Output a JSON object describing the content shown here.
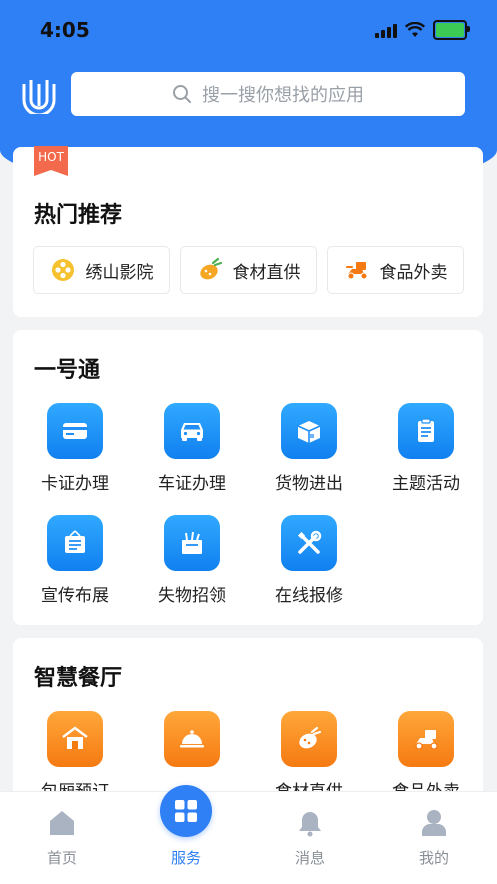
{
  "status_bar": {
    "time": "4:05"
  },
  "search": {
    "placeholder": "搜一搜你想找的应用"
  },
  "hot": {
    "badge": "HOT",
    "title": "热门推荐",
    "items": [
      {
        "label": "绣山影院",
        "icon": "film-reel-icon"
      },
      {
        "label": "食材直供",
        "icon": "vegetables-icon"
      },
      {
        "label": "食品外卖",
        "icon": "delivery-scooter-icon"
      }
    ]
  },
  "yihaotong": {
    "title": "一号通",
    "items": [
      {
        "label": "卡证办理",
        "icon": "card-icon"
      },
      {
        "label": "车证办理",
        "icon": "car-icon"
      },
      {
        "label": "货物进出",
        "icon": "package-icon"
      },
      {
        "label": "主题活动",
        "icon": "clipboard-icon"
      },
      {
        "label": "宣传布展",
        "icon": "display-board-icon"
      },
      {
        "label": "失物招领",
        "icon": "lost-found-box-icon"
      },
      {
        "label": "在线报修",
        "icon": "repair-tools-icon"
      }
    ]
  },
  "canteen": {
    "title": "智慧餐厅",
    "items": [
      {
        "label": "包厢预订",
        "icon": "private-room-icon"
      },
      {
        "label": "",
        "icon": "food-cloche-icon"
      },
      {
        "label": "食材直供",
        "icon": "vegetables-icon"
      },
      {
        "label": "食品外卖",
        "icon": "delivery-scooter-icon"
      }
    ]
  },
  "tabbar": {
    "home": "首页",
    "service": "服务",
    "messages": "消息",
    "mine": "我的"
  },
  "colors": {
    "primary": "#2f7ff5",
    "hot": "#f26a4b",
    "orange_tile": "#f57a12"
  }
}
